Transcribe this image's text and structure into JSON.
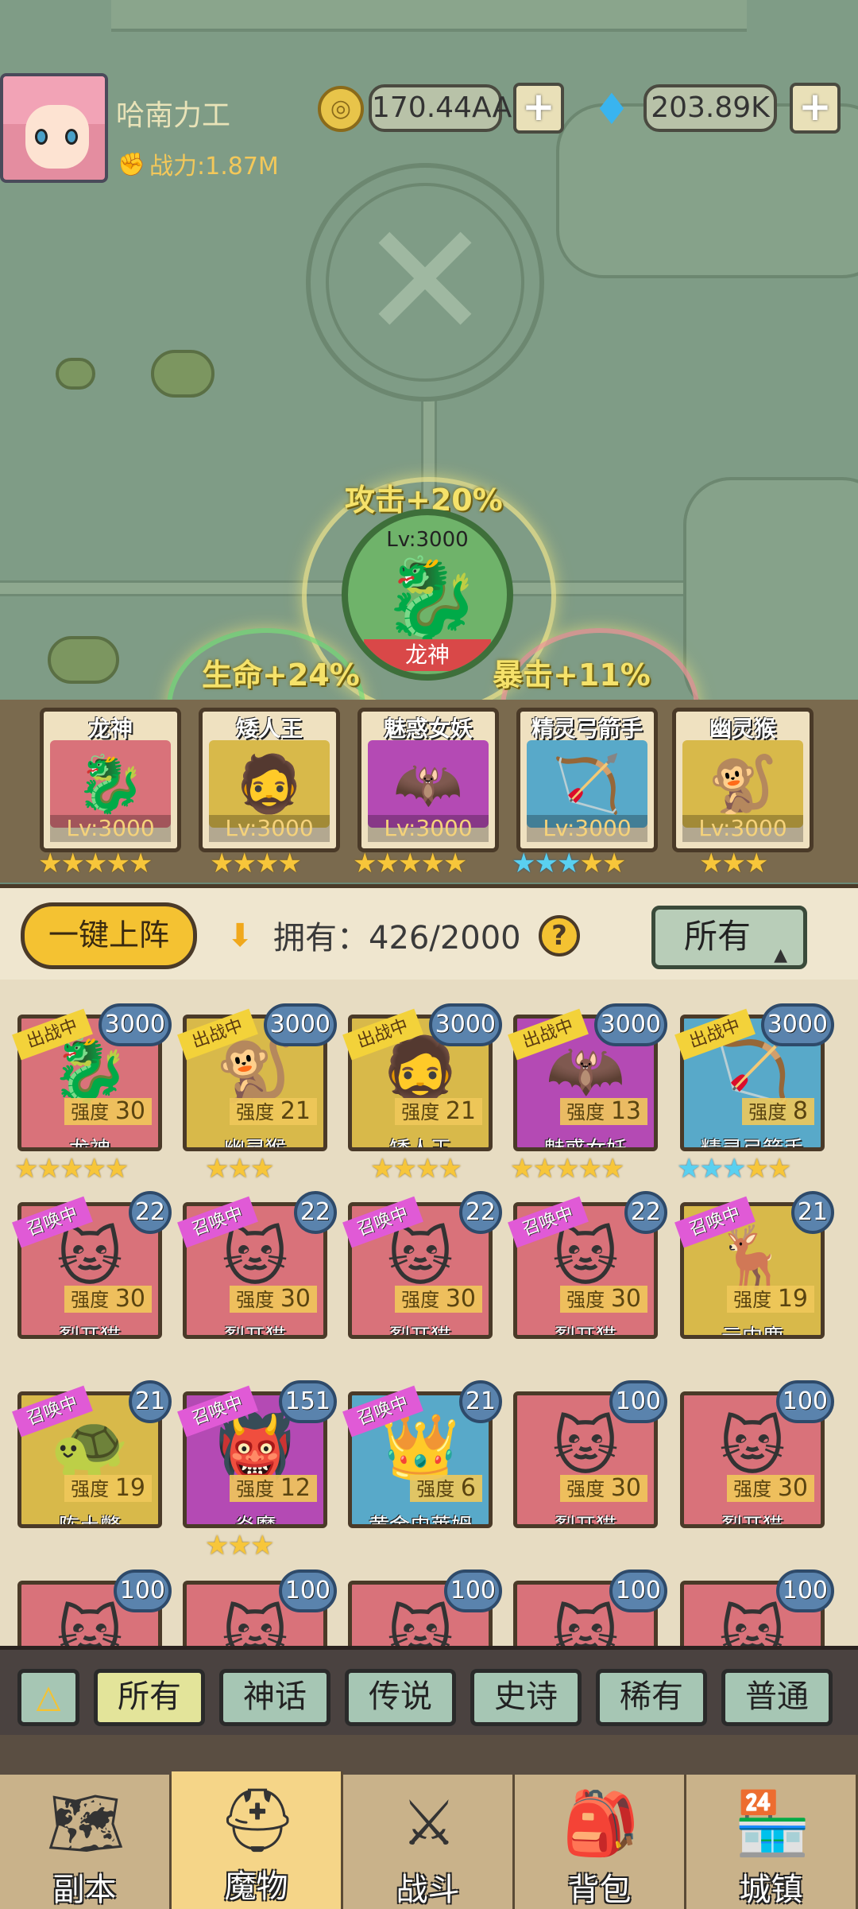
{
  "player": {
    "name": "哈南力工",
    "power_label": "战力:1.87M",
    "coins": "170.44AA",
    "gems": "203.89K"
  },
  "buffs": {
    "attack": "攻击+20%",
    "hp": "生命+24%",
    "crit": "暴击+11%"
  },
  "main_hero": {
    "level": "Lv:3000",
    "name": "龙神"
  },
  "team": [
    {
      "name": "龙神",
      "level": "Lv:3000",
      "stars": "★★★★★",
      "star_color": "yellow"
    },
    {
      "name": "矮人王",
      "level": "Lv:3000",
      "stars": "★★★★",
      "star_color": "yellow"
    },
    {
      "name": "魅惑女妖",
      "level": "Lv:3000",
      "stars": "★★★★★",
      "star_color": "yellow"
    },
    {
      "name": "精灵弓箭手",
      "level": "Lv:3000",
      "stars_blue": "★★★",
      "stars": "★★",
      "star_color": "mixed"
    },
    {
      "name": "幽灵猴",
      "level": "Lv:3000",
      "stars": "★★★",
      "star_color": "yellow"
    }
  ],
  "inventory": {
    "deploy_label": "一键上阵",
    "owned_label": "拥有：426/2000",
    "help": "?",
    "filter_label": "所有"
  },
  "monsters": [
    {
      "name": "龙神",
      "level": "3000",
      "power_prefix": "强度",
      "power": "30",
      "tag": "出战中",
      "stars": "★★★★★",
      "color": "#d9727a"
    },
    {
      "name": "幽灵猴",
      "level": "3000",
      "power_prefix": "强度",
      "power": "21",
      "tag": "出战中",
      "stars": "★★★",
      "color": "#d8b94a"
    },
    {
      "name": "矮人王",
      "level": "3000",
      "power_prefix": "强度",
      "power": "21",
      "tag": "出战中",
      "stars": "★★★★",
      "color": "#d8b94a"
    },
    {
      "name": "魅惑女妖",
      "level": "3000",
      "power_prefix": "强度",
      "power": "13",
      "tag": "出战中",
      "stars": "★★★★★",
      "color": "#b44ab4"
    },
    {
      "name": "精灵弓箭手",
      "level": "3000",
      "power_prefix": "强度",
      "power": "8",
      "tag": "出战中",
      "stars": "★★",
      "stars_blue": "★★★",
      "color": "#58a9c9"
    },
    {
      "name": "裂开猫",
      "level": "22",
      "power_prefix": "强度",
      "power": "30",
      "tag": "召唤中",
      "stars": "",
      "color": "#d9727a"
    },
    {
      "name": "裂开猫",
      "level": "22",
      "power_prefix": "强度",
      "power": "30",
      "tag": "召唤中",
      "stars": "",
      "color": "#d9727a"
    },
    {
      "name": "裂开猫",
      "level": "22",
      "power_prefix": "强度",
      "power": "30",
      "tag": "召唤中",
      "stars": "",
      "color": "#d9727a"
    },
    {
      "name": "裂开猫",
      "level": "22",
      "power_prefix": "强度",
      "power": "30",
      "tag": "召唤中",
      "stars": "",
      "color": "#d9727a"
    },
    {
      "name": "云中鹿",
      "level": "21",
      "power_prefix": "强度",
      "power": "19",
      "tag": "召唤中",
      "stars": "",
      "color": "#d8b94a"
    },
    {
      "name": "陈土鳖",
      "level": "21",
      "power_prefix": "强度",
      "power": "19",
      "tag": "召唤中",
      "stars": "",
      "color": "#d8b94a"
    },
    {
      "name": "炎魔",
      "level": "151",
      "power_prefix": "强度",
      "power": "12",
      "tag": "召唤中",
      "stars": "★★★",
      "color": "#b44ab4"
    },
    {
      "name": "黄金史莱姆",
      "level": "21",
      "power_prefix": "强度",
      "power": "6",
      "tag": "召唤中",
      "stars": "",
      "color": "#58a9c9"
    },
    {
      "name": "裂开猫",
      "level": "100",
      "power_prefix": "强度",
      "power": "30",
      "tag": "",
      "stars": "",
      "color": "#d9727a"
    },
    {
      "name": "裂开猫",
      "level": "100",
      "power_prefix": "强度",
      "power": "30",
      "tag": "",
      "stars": "",
      "color": "#d9727a"
    },
    {
      "name": "",
      "level": "100",
      "power_prefix": "",
      "power": "",
      "tag": "",
      "stars": "",
      "color": "#d9727a"
    },
    {
      "name": "",
      "level": "100",
      "power_prefix": "",
      "power": "",
      "tag": "",
      "stars": "",
      "color": "#d9727a"
    },
    {
      "name": "",
      "level": "100",
      "power_prefix": "",
      "power": "",
      "tag": "",
      "stars": "",
      "color": "#d9727a"
    },
    {
      "name": "",
      "level": "100",
      "power_prefix": "",
      "power": "",
      "tag": "",
      "stars": "",
      "color": "#d9727a"
    },
    {
      "name": "",
      "level": "100",
      "power_prefix": "",
      "power": "",
      "tag": "",
      "stars": "",
      "color": "#d9727a"
    }
  ],
  "rarity_tabs": [
    "所有",
    "神话",
    "传说",
    "史诗",
    "稀有",
    "普通"
  ],
  "rarity_active": 0,
  "bottom_nav": [
    {
      "label": "副本",
      "icon": "map-icon",
      "glyph": "🗺"
    },
    {
      "label": "魔物",
      "icon": "helmet-icon",
      "glyph": "⛑"
    },
    {
      "label": "战斗",
      "icon": "crossed-swords-icon",
      "glyph": "⚔"
    },
    {
      "label": "背包",
      "icon": "backpack-icon",
      "glyph": "🎒"
    },
    {
      "label": "城镇",
      "icon": "shop-icon",
      "glyph": "🏪"
    }
  ],
  "bottom_nav_active": 1
}
